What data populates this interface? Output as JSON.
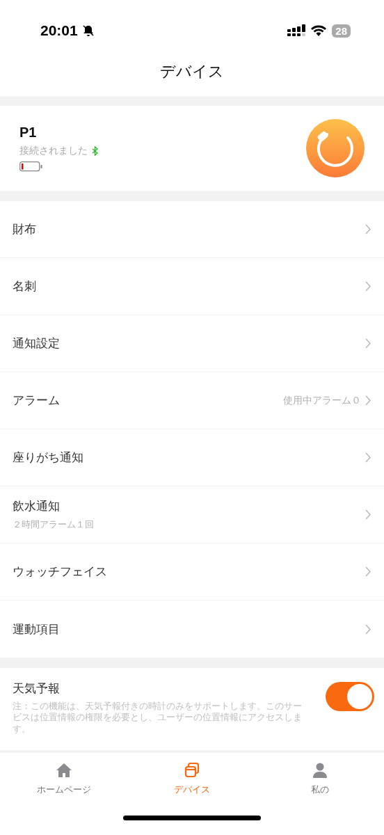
{
  "status_bar": {
    "time": "20:01",
    "battery": "28"
  },
  "header": {
    "title": "デバイス"
  },
  "device": {
    "name": "P1",
    "status": "接続されました",
    "connected": true
  },
  "menu": [
    {
      "label": "財布"
    },
    {
      "label": "名刺"
    },
    {
      "label": "通知設定"
    },
    {
      "label": "アラーム",
      "value": "使用中アラーム０"
    },
    {
      "label": "座りがち通知"
    },
    {
      "label": "飲水通知",
      "subtitle": "２時間アラーム１回"
    },
    {
      "label": "ウォッチフェイス"
    },
    {
      "label": "運動項目"
    }
  ],
  "weather": {
    "label": "天気予報",
    "note": "注：この機能は、天気予報付きの時計のみをサポートします。このサービスは位置情報の権限を必要とし、ユーザーの位置情報にアクセスします。",
    "on": true
  },
  "tabs": [
    {
      "label": "ホームページ",
      "kind": "home",
      "selected": false
    },
    {
      "label": "デバイス",
      "kind": "device",
      "selected": true
    },
    {
      "label": "私の",
      "kind": "me",
      "selected": false
    }
  ]
}
